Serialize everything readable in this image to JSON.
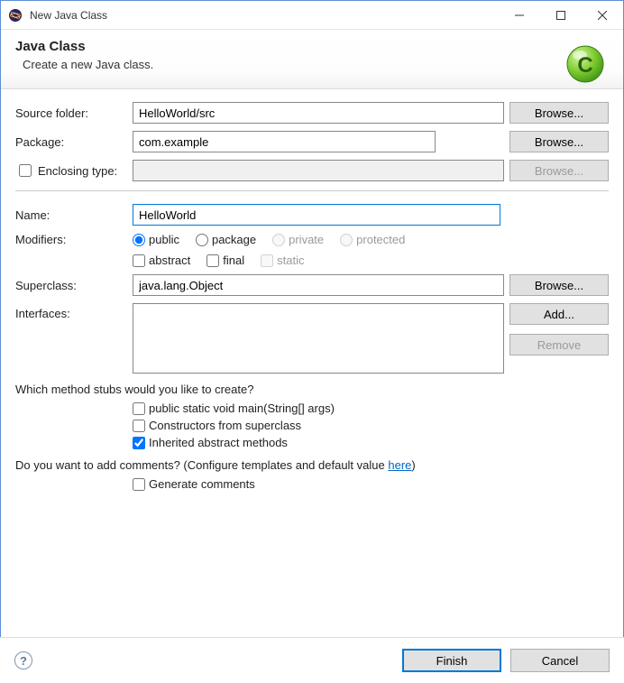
{
  "window": {
    "title": "New Java Class"
  },
  "banner": {
    "heading": "Java Class",
    "sub": "Create a new Java class."
  },
  "labels": {
    "source_folder": "Source folder:",
    "package": "Package:",
    "enclosing_type": "Enclosing type:",
    "name": "Name:",
    "modifiers": "Modifiers:",
    "superclass": "Superclass:",
    "interfaces": "Interfaces:"
  },
  "buttons": {
    "browse": "Browse...",
    "add": "Add...",
    "remove": "Remove",
    "finish": "Finish",
    "cancel": "Cancel"
  },
  "fields": {
    "source_folder": "HelloWorld/src",
    "package": "com.example",
    "enclosing_type": "",
    "name": "HelloWorld",
    "superclass": "java.lang.Object"
  },
  "modifiers": {
    "visibility": {
      "public": "public",
      "package": "package",
      "private": "private",
      "protected": "protected",
      "selected": "public"
    },
    "flags": {
      "abstract": "abstract",
      "final": "final",
      "static": "static"
    }
  },
  "stubs": {
    "question": "Which method stubs would you like to create?",
    "main": "public static void main(String[] args)",
    "constructors": "Constructors from superclass",
    "inherited": "Inherited abstract methods"
  },
  "comments": {
    "question_prefix": "Do you want to add comments? (Configure templates and default value ",
    "link": "here",
    "question_suffix": ")",
    "generate": "Generate comments"
  },
  "help_glyph": "?"
}
